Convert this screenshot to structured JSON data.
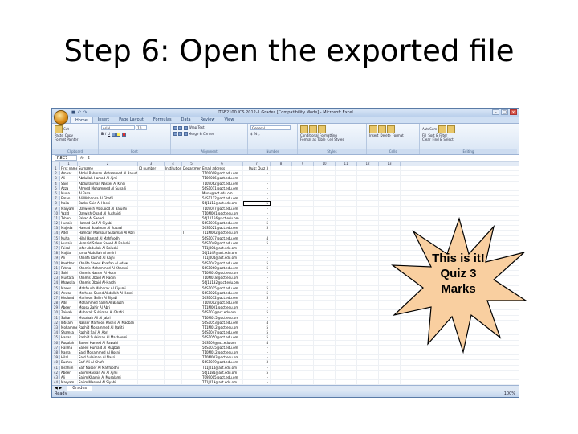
{
  "slide": {
    "title": "Step 6: Open the exported file",
    "callout_lines": [
      "This is it!",
      "Quiz 3",
      "Marks"
    ],
    "callout_fill": "#f9cfa0",
    "callout_stroke": "#000000"
  },
  "excel": {
    "window_title": "ITSE2100 ICS 2012-1 Grades  [Compatibility Mode] - Microsoft Excel",
    "tabs": [
      "Home",
      "Insert",
      "Page Layout",
      "Formulas",
      "Data",
      "Review",
      "View"
    ],
    "active_tab": "Home",
    "ribbon": {
      "clipboard": {
        "paste": "Paste",
        "cut": "Cut",
        "copy": "Copy",
        "format_painter": "Format Painter",
        "group": "Clipboard"
      },
      "font": {
        "name": "Arial",
        "size": "10",
        "group": "Font"
      },
      "alignment": {
        "wrap": "Wrap Text",
        "merge": "Merge & Center",
        "group": "Alignment"
      },
      "number": {
        "format": "General",
        "group": "Number"
      },
      "styles": {
        "conditional": "Conditional Formatting",
        "format_table": "Format as Table",
        "cell_styles": "Cell Styles",
        "group": "Styles"
      },
      "cells": {
        "insert": "Insert",
        "delete": "Delete",
        "format": "Format",
        "group": "Cells"
      },
      "editing": {
        "autosum": "AutoSum",
        "fill": "Fill",
        "clear": "Clear",
        "sort": "Sort & Filter",
        "find": "Find & Select",
        "group": "Editing"
      }
    },
    "name_box": "R8C7",
    "fx_label": "fx",
    "formula_value": "5",
    "column_headers": [
      "1",
      "2",
      "3",
      "4",
      "5",
      "6",
      "7",
      "8",
      "9",
      "10",
      "11",
      "12",
      "13"
    ],
    "header_row": [
      "First name",
      "Surname",
      "ID number",
      "Institution",
      "Department",
      "Email address",
      "Quiz: Quiz 3"
    ],
    "rows": [
      [
        "Amaar",
        "Abdul Rahman Mohammed Al Balushi",
        "",
        "",
        "",
        "T10S008@act.edu.om",
        "-"
      ],
      [
        "Ali",
        "Abdullah Hamad Al Ajmi",
        "",
        "",
        "",
        "T10S006@act.edu.om",
        "-"
      ],
      [
        "Said",
        "Abdulrahman Nasser Al Kindi",
        "",
        "",
        "",
        "T10S062@act.edu.om",
        "-"
      ],
      [
        "Azza",
        "Ahmed Mohammed Al Suhaili",
        "",
        "",
        "",
        "56S1011@act.edu.om",
        "-"
      ],
      [
        "Muna",
        "Al Fana",
        "",
        "",
        "",
        "Muna@act.edu.om",
        "-"
      ],
      [
        "Eman",
        "Ali Mohanna Al Ghafri",
        "",
        "",
        "",
        "54S1112@act.edu.om",
        "-"
      ],
      [
        "Naila",
        "Bader Said Al Hosni",
        "",
        "",
        "",
        "56J1115@act.edu.om",
        "5"
      ],
      [
        "Maryam",
        "Darweesh Masuood Al Balushi",
        "",
        "",
        "",
        "T10S047@act.edu.om",
        "-"
      ],
      [
        "Yazid",
        "Darwish Obaid Al Rushaidi",
        "",
        "",
        "",
        "T10M001@act.edu.om",
        "-"
      ],
      [
        "Tahani",
        "Fahad Al Saeedi",
        "",
        "",
        "",
        "56J11156@act.edu.om",
        "-"
      ],
      [
        "Hunaih",
        "Hamad Saif Al Siyabi",
        "",
        "",
        "",
        "56S1036@act.edu.om",
        "5"
      ],
      [
        "Majeda",
        "Hamad Sulaiman Al Rubaai",
        "",
        "",
        "",
        "56S1021@act.edu.om",
        "5"
      ],
      [
        "Adel",
        "Hamdan Mansour Sulaiman Al Abri",
        "",
        "",
        "IT",
        "T11M002@act.edu.om",
        ""
      ],
      [
        "Nuha",
        "Hilal Hamad Al Mahfoodhi",
        "",
        "",
        "",
        "56S1037@act.edu.om",
        "4"
      ],
      [
        "Hunaih",
        "Humaid Salem Saeed Al Balushi",
        "",
        "",
        "",
        "56S1048@act.edu.om",
        "5"
      ],
      [
        "Faisal",
        "Jafar Abdullah Al Balushi",
        "",
        "",
        "",
        "T11J003@act.edu.om",
        "-"
      ],
      [
        "Majda",
        "Juma Abdullah Al Amiri",
        "",
        "",
        "",
        "56J1147@act.edu.om",
        "-"
      ],
      [
        "Ali",
        "Khalifa Rashid Al Rajhi",
        "",
        "",
        "",
        "T11J004@act.edu.om",
        "-"
      ],
      [
        "Kawthar",
        "Khalifa Saeed Khalfan Al Adawi",
        "",
        "",
        "",
        "56S1042@act.edu.om",
        "5"
      ],
      [
        "Fatma",
        "Khamis Mohammed Al Kharusi",
        "",
        "",
        "",
        "56S1060@act.edu.om",
        "5"
      ],
      [
        "Said",
        "Khamis Nasser Al Hosni",
        "",
        "",
        "",
        "T10M016@act.edu.om",
        "-"
      ],
      [
        "Mustafa",
        "Khamis Obaid Al Radini",
        "",
        "",
        "",
        "T10M018@act.edu.om",
        "-"
      ],
      [
        "Khawala",
        "Khamis Obaid Al-Harthi",
        "",
        "",
        "",
        "56J11132@act.edu.om",
        "-"
      ],
      [
        "Marwa",
        "Mahfoudh Mubarak Al Kiyumi",
        "",
        "",
        "",
        "56S1015@act.edu.om",
        "5"
      ],
      [
        "Anwar",
        "Marhoon Saeed Abdullah Al Hosni",
        "",
        "",
        "",
        "56S1026@act.edu.om",
        "5"
      ],
      [
        "Kholoud",
        "Marhoon Salim Al Siyabi",
        "",
        "",
        "",
        "56S1032@act.edu.om",
        "5"
      ],
      [
        "Adil",
        "Mohammed Saleh Al Balushi",
        "",
        "",
        "",
        "T10S002@act.edu.om",
        "-"
      ],
      [
        "Abeer",
        "Moosa Zahir Al Abri",
        "",
        "",
        "",
        "T11M001@act.edu.om",
        "-"
      ],
      [
        "Zainab",
        "Mubarak Sulaiman Al Ghafri",
        "",
        "",
        "",
        "56S107@act.edu.om",
        "5"
      ],
      [
        "Sultan",
        "Musabah Ali Al Jabri",
        "",
        "",
        "",
        "T10M015@act.edu.om",
        "-"
      ],
      [
        "Ibtisam",
        "Nasser Marhoon Rashid Al Maqbali",
        "",
        "",
        "",
        "56S1053@act.edu.om",
        "4"
      ],
      [
        "Mohamme",
        "Rashid Mohammed Al Qatiti",
        "",
        "",
        "",
        "T11M012@act.edu.om",
        "5"
      ],
      [
        "Shamsa",
        "Rashid Saif Al Abri",
        "",
        "",
        "",
        "56S1047@act.edu.om",
        "5"
      ],
      [
        "Hanan",
        "Rashid Sulaiman Al Makhoomi",
        "",
        "",
        "",
        "56S1050@act.edu.om",
        "5"
      ],
      [
        "Ruqaiah",
        "Saeed Hamed Al Rawahi",
        "",
        "",
        "",
        "56S109@act.edu.om",
        "4"
      ],
      [
        "Halima",
        "Saeed Humaid Al Muqbali",
        "",
        "",
        "",
        "56S1035@act.edu.om",
        "-"
      ],
      [
        "Nasra",
        "Said Mohammed Al Hosni",
        "",
        "",
        "",
        "T10M012@act.edu.om",
        "-"
      ],
      [
        "Hilal",
        "Said Sulaiman Al Nasri",
        "",
        "",
        "",
        "T10M003@act.edu.om",
        "-"
      ],
      [
        "Bushra",
        "Saif Ali Al Ghafri",
        "",
        "",
        "",
        "56S1019@act.edu.om",
        "3"
      ],
      [
        "Ibrahim",
        "Saif Nasser Al Mahfoodhi",
        "",
        "",
        "",
        "T11J014@act.edu.om",
        "-"
      ],
      [
        "Abeer",
        "Salim Hassan Ali Al Ajmi",
        "",
        "",
        "",
        "56J1181@act.edu.om",
        "5"
      ],
      [
        "Ali",
        "Salim Khamis Al Musalami",
        "",
        "",
        "",
        "T09S005@act.edu.om",
        "-"
      ],
      [
        "Maryam",
        "Salim Masuod Al Siyabi",
        "",
        "",
        "",
        "T11J019@act.edu.om",
        "-"
      ],
      [
        "Munira",
        "Shams Saleem Al Mazidi",
        "",
        "",
        "",
        "56S1018@act.edu.om",
        "5"
      ]
    ],
    "selected_row_index": 6,
    "sheet_tab": "Grades",
    "status": "Ready",
    "zoom": "100%"
  }
}
